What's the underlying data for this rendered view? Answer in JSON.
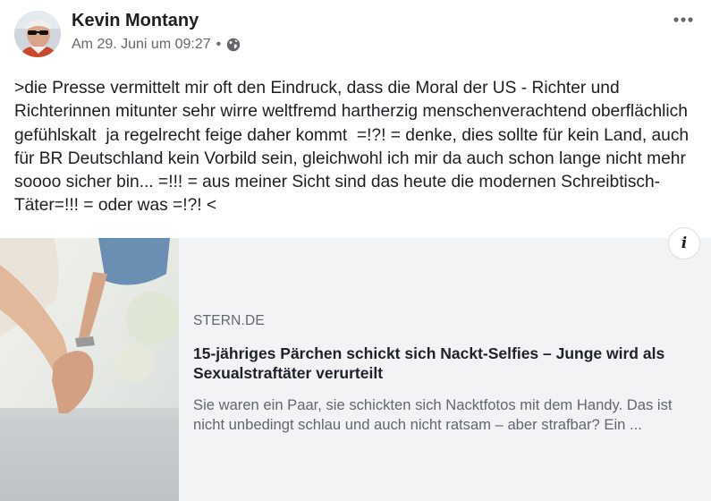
{
  "post": {
    "author": "Kevin Montany",
    "timestamp": "Am 29. Juni um 09:27",
    "separator": "•",
    "privacy_icon": "globe-icon",
    "more_icon": "more-options-icon",
    "text": ">die Presse vermittelt mir oft den Eindruck, dass die Moral der US - Richter und Richterinnen mitunter sehr wirre weltfremd hartherzig menschenverachtend oberflächlich gefühlskalt  ja regelrecht feige daher kommt  =!?! = denke, dies sollte für kein Land, auch für BR Deutschland kein Vorbild sein, gleichwohl ich mir da auch schon lange nicht mehr soooo sicher bin... =!!! = aus meiner Sicht sind das heute die modernen Schreibtisch-Täter=!!! = oder was =!?! <"
  },
  "link_card": {
    "domain": "STERN.DE",
    "headline": "15-jähriges Pärchen schickt sich Nackt-Selfies – Junge wird als Sexualstraftäter verurteilt",
    "description": "Sie waren ein Paar, sie schickten sich Nacktfotos mit dem Handy. Das ist nicht unbedingt schlau und auch nicht ratsam – aber strafbar? Ein ...",
    "info_label": "i",
    "image_subject": "holding-hands-photo"
  },
  "colors": {
    "text": "#1c1e21",
    "secondary_text": "#65676b",
    "card_background": "#f2f3f5"
  }
}
